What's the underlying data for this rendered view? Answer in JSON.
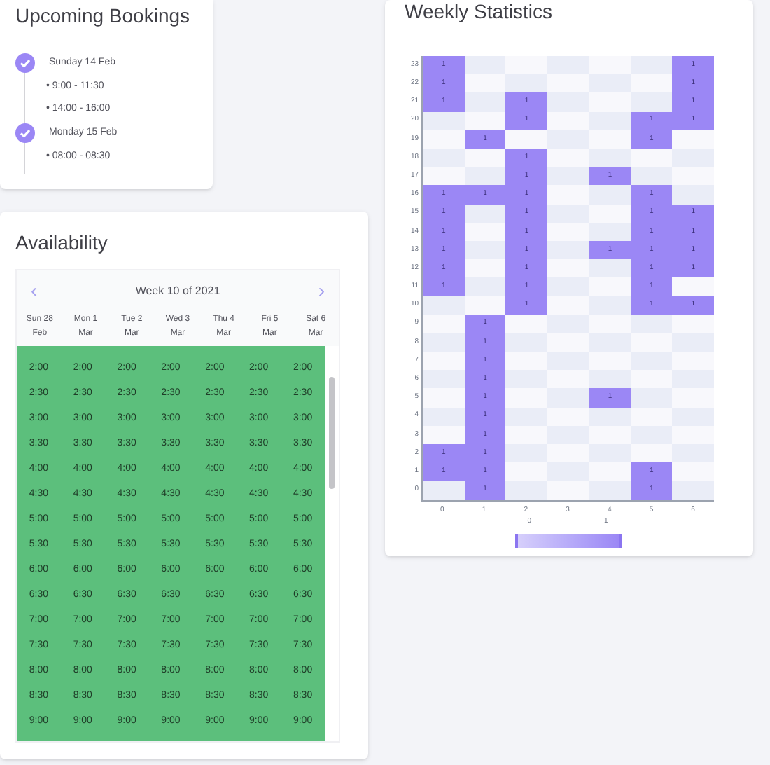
{
  "bookings_card": {
    "title": "Upcoming Bookings",
    "days": [
      {
        "date": "Sunday 14 Feb",
        "done": true,
        "slots": [
          "• 9:00 - 11:30",
          "• 14:00 - 16:00"
        ]
      },
      {
        "date": "Monday 15 Feb",
        "done": true,
        "slots": [
          "• 08:00 - 08:30"
        ]
      }
    ]
  },
  "availability": {
    "title": "Availability",
    "week_label": "Week 10 of 2021",
    "prev": "‹",
    "next": "›",
    "days": [
      {
        "top": "Sun 28",
        "bottom": "Feb"
      },
      {
        "top": "Mon 1",
        "bottom": "Mar"
      },
      {
        "top": "Tue 2",
        "bottom": "Mar"
      },
      {
        "top": "Wed 3",
        "bottom": "Mar"
      },
      {
        "top": "Thu 4",
        "bottom": "Mar"
      },
      {
        "top": "Fri 5",
        "bottom": "Mar"
      },
      {
        "top": "Sat 6",
        "bottom": "Mar"
      }
    ],
    "rows": [
      {
        "available": true,
        "cells": [
          "2:00",
          "2:00",
          "2:00",
          "2:00",
          "2:00",
          "2:00",
          "2:00"
        ]
      },
      {
        "available": true,
        "cells": [
          "2:30",
          "2:30",
          "2:30",
          "2:30",
          "2:30",
          "2:30",
          "2:30"
        ]
      },
      {
        "available": true,
        "cells": [
          "3:00",
          "3:00",
          "3:00",
          "3:00",
          "3:00",
          "3:00",
          "3:00"
        ]
      },
      {
        "available": true,
        "cells": [
          "3:30",
          "3:30",
          "3:30",
          "3:30",
          "3:30",
          "3:30",
          "3:30"
        ]
      },
      {
        "available": true,
        "cells": [
          "4:00",
          "4:00",
          "4:00",
          "4:00",
          "4:00",
          "4:00",
          "4:00"
        ]
      },
      {
        "available": true,
        "cells": [
          "4:30",
          "4:30",
          "4:30",
          "4:30",
          "4:30",
          "4:30",
          "4:30"
        ]
      },
      {
        "available": true,
        "cells": [
          "5:00",
          "5:00",
          "5:00",
          "5:00",
          "5:00",
          "5:00",
          "5:00"
        ]
      },
      {
        "available": true,
        "cells": [
          "5:30",
          "5:30",
          "5:30",
          "5:30",
          "5:30",
          "5:30",
          "5:30"
        ]
      },
      {
        "available": true,
        "cells": [
          "6:00",
          "6:00",
          "6:00",
          "6:00",
          "6:00",
          "6:00",
          "6:00"
        ]
      },
      {
        "available": true,
        "cells": [
          "6:30",
          "6:30",
          "6:30",
          "6:30",
          "6:30",
          "6:30",
          "6:30"
        ]
      },
      {
        "available": true,
        "cells": [
          "7:00",
          "7:00",
          "7:00",
          "7:00",
          "7:00",
          "7:00",
          "7:00"
        ]
      },
      {
        "available": true,
        "cells": [
          "7:30",
          "7:30",
          "7:30",
          "7:30",
          "7:30",
          "7:30",
          "7:30"
        ]
      },
      {
        "available": true,
        "cells": [
          "8:00",
          "8:00",
          "8:00",
          "8:00",
          "8:00",
          "8:00",
          "8:00"
        ]
      },
      {
        "available": true,
        "cells": [
          "8:30",
          "8:30",
          "8:30",
          "8:30",
          "8:30",
          "8:30",
          "8:30"
        ]
      },
      {
        "available": true,
        "cells": [
          "9:00",
          "9:00",
          "9:00",
          "9:00",
          "9:00",
          "9:00",
          "9:00"
        ]
      }
    ]
  },
  "statistics": {
    "title": "Weekly Statistics",
    "x_labels": [
      "0",
      "1",
      "2",
      "3",
      "4",
      "5",
      "6"
    ],
    "rows": [
      {
        "label": "23",
        "cells": [
          {
            "filled": true,
            "value": "1"
          },
          {
            "filled": false
          },
          {
            "filled": false
          },
          {
            "filled": false
          },
          {
            "filled": false
          },
          {
            "filled": false
          },
          {
            "filled": true,
            "value": "1"
          }
        ]
      },
      {
        "label": "22",
        "cells": [
          {
            "filled": true,
            "value": "1"
          },
          {
            "filled": false
          },
          {
            "filled": false
          },
          {
            "filled": false
          },
          {
            "filled": false
          },
          {
            "filled": false
          },
          {
            "filled": true,
            "value": "1"
          }
        ]
      },
      {
        "label": "21",
        "cells": [
          {
            "filled": true,
            "value": "1"
          },
          {
            "filled": false
          },
          {
            "filled": true,
            "value": "1"
          },
          {
            "filled": false
          },
          {
            "filled": false
          },
          {
            "filled": false
          },
          {
            "filled": true,
            "value": "1"
          }
        ]
      },
      {
        "label": "20",
        "cells": [
          {
            "filled": false
          },
          {
            "filled": false
          },
          {
            "filled": true,
            "value": "1"
          },
          {
            "filled": false
          },
          {
            "filled": false
          },
          {
            "filled": true,
            "value": "1"
          },
          {
            "filled": true,
            "value": "1"
          }
        ]
      },
      {
        "label": "19",
        "cells": [
          {
            "filled": false
          },
          {
            "filled": true,
            "value": "1"
          },
          {
            "filled": false
          },
          {
            "filled": false
          },
          {
            "filled": false
          },
          {
            "filled": true,
            "value": "1"
          },
          {
            "filled": false
          }
        ]
      },
      {
        "label": "18",
        "cells": [
          {
            "filled": false
          },
          {
            "filled": false
          },
          {
            "filled": true,
            "value": "1"
          },
          {
            "filled": false
          },
          {
            "filled": false
          },
          {
            "filled": false
          },
          {
            "filled": false
          }
        ]
      },
      {
        "label": "17",
        "cells": [
          {
            "filled": false
          },
          {
            "filled": false
          },
          {
            "filled": true,
            "value": "1"
          },
          {
            "filled": false
          },
          {
            "filled": true,
            "value": "1"
          },
          {
            "filled": false
          },
          {
            "filled": false
          }
        ]
      },
      {
        "label": "16",
        "cells": [
          {
            "filled": true,
            "value": "1"
          },
          {
            "filled": true,
            "value": "1"
          },
          {
            "filled": true,
            "value": "1"
          },
          {
            "filled": false
          },
          {
            "filled": false
          },
          {
            "filled": true,
            "value": "1"
          },
          {
            "filled": false
          }
        ]
      },
      {
        "label": "15",
        "cells": [
          {
            "filled": true,
            "value": "1"
          },
          {
            "filled": false
          },
          {
            "filled": true,
            "value": "1"
          },
          {
            "filled": false
          },
          {
            "filled": false
          },
          {
            "filled": true,
            "value": "1"
          },
          {
            "filled": true,
            "value": "1"
          }
        ]
      },
      {
        "label": "14",
        "cells": [
          {
            "filled": true,
            "value": "1"
          },
          {
            "filled": false
          },
          {
            "filled": true,
            "value": "1"
          },
          {
            "filled": false
          },
          {
            "filled": false
          },
          {
            "filled": true,
            "value": "1"
          },
          {
            "filled": true,
            "value": "1"
          }
        ]
      },
      {
        "label": "13",
        "cells": [
          {
            "filled": true,
            "value": "1"
          },
          {
            "filled": false
          },
          {
            "filled": true,
            "value": "1"
          },
          {
            "filled": false
          },
          {
            "filled": true,
            "value": "1"
          },
          {
            "filled": true,
            "value": "1"
          },
          {
            "filled": true,
            "value": "1"
          }
        ]
      },
      {
        "label": "12",
        "cells": [
          {
            "filled": true,
            "value": "1"
          },
          {
            "filled": false
          },
          {
            "filled": true,
            "value": "1"
          },
          {
            "filled": false
          },
          {
            "filled": false
          },
          {
            "filled": true,
            "value": "1"
          },
          {
            "filled": true,
            "value": "1"
          }
        ]
      },
      {
        "label": "11",
        "cells": [
          {
            "filled": true,
            "value": "1"
          },
          {
            "filled": false
          },
          {
            "filled": true,
            "value": "1"
          },
          {
            "filled": false
          },
          {
            "filled": false
          },
          {
            "filled": true,
            "value": "1"
          },
          {
            "filled": false
          }
        ]
      },
      {
        "label": "10",
        "cells": [
          {
            "filled": false
          },
          {
            "filled": false
          },
          {
            "filled": true,
            "value": "1"
          },
          {
            "filled": false
          },
          {
            "filled": false
          },
          {
            "filled": true,
            "value": "1"
          },
          {
            "filled": true,
            "value": "1"
          }
        ]
      },
      {
        "label": "9",
        "cells": [
          {
            "filled": false
          },
          {
            "filled": true,
            "value": "1"
          },
          {
            "filled": false
          },
          {
            "filled": false
          },
          {
            "filled": false
          },
          {
            "filled": false
          },
          {
            "filled": false
          }
        ]
      },
      {
        "label": "8",
        "cells": [
          {
            "filled": false
          },
          {
            "filled": true,
            "value": "1"
          },
          {
            "filled": false
          },
          {
            "filled": false
          },
          {
            "filled": false
          },
          {
            "filled": false
          },
          {
            "filled": false
          }
        ]
      },
      {
        "label": "7",
        "cells": [
          {
            "filled": false
          },
          {
            "filled": true,
            "value": "1"
          },
          {
            "filled": false
          },
          {
            "filled": false
          },
          {
            "filled": false
          },
          {
            "filled": false
          },
          {
            "filled": false
          }
        ]
      },
      {
        "label": "6",
        "cells": [
          {
            "filled": false
          },
          {
            "filled": true,
            "value": "1"
          },
          {
            "filled": false
          },
          {
            "filled": false
          },
          {
            "filled": false
          },
          {
            "filled": false
          },
          {
            "filled": false
          }
        ]
      },
      {
        "label": "5",
        "cells": [
          {
            "filled": false
          },
          {
            "filled": true,
            "value": "1"
          },
          {
            "filled": false
          },
          {
            "filled": false
          },
          {
            "filled": true,
            "value": "1"
          },
          {
            "filled": false
          },
          {
            "filled": false
          }
        ]
      },
      {
        "label": "4",
        "cells": [
          {
            "filled": false
          },
          {
            "filled": true,
            "value": "1"
          },
          {
            "filled": false
          },
          {
            "filled": false
          },
          {
            "filled": false
          },
          {
            "filled": false
          },
          {
            "filled": false
          }
        ]
      },
      {
        "label": "3",
        "cells": [
          {
            "filled": false
          },
          {
            "filled": true,
            "value": "1"
          },
          {
            "filled": false
          },
          {
            "filled": false
          },
          {
            "filled": false
          },
          {
            "filled": false
          },
          {
            "filled": false
          }
        ]
      },
      {
        "label": "2",
        "cells": [
          {
            "filled": true,
            "value": "1"
          },
          {
            "filled": true,
            "value": "1"
          },
          {
            "filled": false
          },
          {
            "filled": false
          },
          {
            "filled": false
          },
          {
            "filled": false
          },
          {
            "filled": false
          }
        ]
      },
      {
        "label": "1",
        "cells": [
          {
            "filled": true,
            "value": "1"
          },
          {
            "filled": true,
            "value": "1"
          },
          {
            "filled": false
          },
          {
            "filled": false
          },
          {
            "filled": false
          },
          {
            "filled": true,
            "value": "1"
          },
          {
            "filled": false
          }
        ]
      },
      {
        "label": "0",
        "cells": [
          {
            "filled": false
          },
          {
            "filled": true,
            "value": "1"
          },
          {
            "filled": false
          },
          {
            "filled": false
          },
          {
            "filled": false
          },
          {
            "filled": true,
            "value": "1"
          },
          {
            "filled": false
          }
        ]
      }
    ],
    "legend": {
      "min": "0",
      "max": "1"
    }
  }
}
